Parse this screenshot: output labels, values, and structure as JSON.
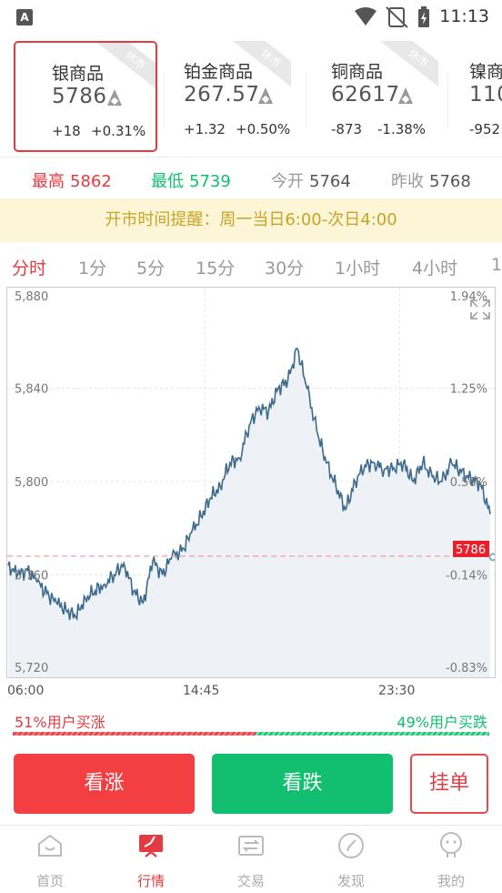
{
  "status_bar": {
    "time": "11:13",
    "app_icon_letter": "A"
  },
  "instruments": [
    {
      "name": "银商品",
      "price": "5786",
      "change": "+18",
      "percent": "+0.31%",
      "badge": "休市",
      "active": true
    },
    {
      "name": "铂金商品",
      "price": "267.57",
      "change": "+1.32",
      "percent": "+0.50%",
      "badge": "休市",
      "active": false
    },
    {
      "name": "铜商品",
      "price": "62617",
      "change": "-873",
      "percent": "-1.38%",
      "badge": "休市",
      "active": false
    },
    {
      "name": "镍商",
      "price": "110",
      "change": "-952",
      "percent": "",
      "badge": "",
      "active": false
    }
  ],
  "stats": {
    "high_label": "最高",
    "high_value": "5862",
    "low_label": "最低",
    "low_value": "5739",
    "open_label": "今开",
    "open_value": "5764",
    "prev_label": "昨收",
    "prev_value": "5768"
  },
  "notice": "开市时间提醒：周一当日6:00-次日4:00",
  "periods": [
    "分时",
    "1分",
    "5分",
    "15分",
    "30分",
    "1小时",
    "4小时",
    "1"
  ],
  "active_period": "分时",
  "chart_data": {
    "type": "line",
    "y_left_ticks": [
      "5,880",
      "5,840",
      "5,800",
      "5,760",
      "5,720"
    ],
    "y_right_ticks": [
      "1.94%",
      "1.25%",
      "0.56%",
      "-0.14%",
      "-0.83%"
    ],
    "x_ticks": [
      "06:00",
      "14:45",
      "23:30"
    ],
    "ylim": [
      5720,
      5880
    ],
    "prev_close": 5768,
    "last_price_label": "5786",
    "x": [
      0,
      2,
      4,
      6,
      8,
      10,
      12,
      14,
      16,
      18,
      20,
      22,
      24,
      26,
      28,
      30,
      32,
      34,
      36,
      38,
      40,
      42,
      44,
      46,
      48,
      50,
      52,
      54,
      56,
      58,
      60,
      62,
      64,
      66,
      68,
      70,
      72,
      74,
      76,
      78,
      80,
      82,
      84,
      86,
      88,
      90,
      92,
      94,
      96,
      98,
      100
    ],
    "y": [
      5764,
      5760,
      5762,
      5757,
      5752,
      5748,
      5745,
      5742,
      5750,
      5753,
      5756,
      5760,
      5765,
      5753,
      5748,
      5766,
      5760,
      5768,
      5770,
      5778,
      5785,
      5793,
      5798,
      5808,
      5810,
      5824,
      5832,
      5830,
      5840,
      5843,
      5857,
      5840,
      5822,
      5808,
      5798,
      5788,
      5800,
      5807,
      5808,
      5805,
      5806,
      5808,
      5800,
      5808,
      5802,
      5800,
      5808,
      5804,
      5801,
      5799,
      5786
    ],
    "colors": {
      "line": "#3b6a8c",
      "fill": "#eef2f6",
      "prev_close": "#f0a0a8",
      "price_tag": "#e8202a"
    }
  },
  "sentiment": {
    "buy_up": "51%用户买涨",
    "buy_down": "49%用户买跌",
    "up_ratio": 0.51
  },
  "actions": {
    "buy_up": "看涨",
    "buy_down": "看跌",
    "order": "挂单"
  },
  "nav": [
    {
      "label": "首页",
      "icon": "home-icon",
      "active": false
    },
    {
      "label": "行情",
      "icon": "market-icon",
      "active": true
    },
    {
      "label": "交易",
      "icon": "trade-icon",
      "active": false
    },
    {
      "label": "发现",
      "icon": "discover-icon",
      "active": false
    },
    {
      "label": "我的",
      "icon": "profile-icon",
      "active": false
    }
  ],
  "colors": {
    "red": "#e23b41",
    "green": "#12be6f",
    "notice_bg": "#fdf6d6",
    "notice_text": "#c9a227"
  }
}
